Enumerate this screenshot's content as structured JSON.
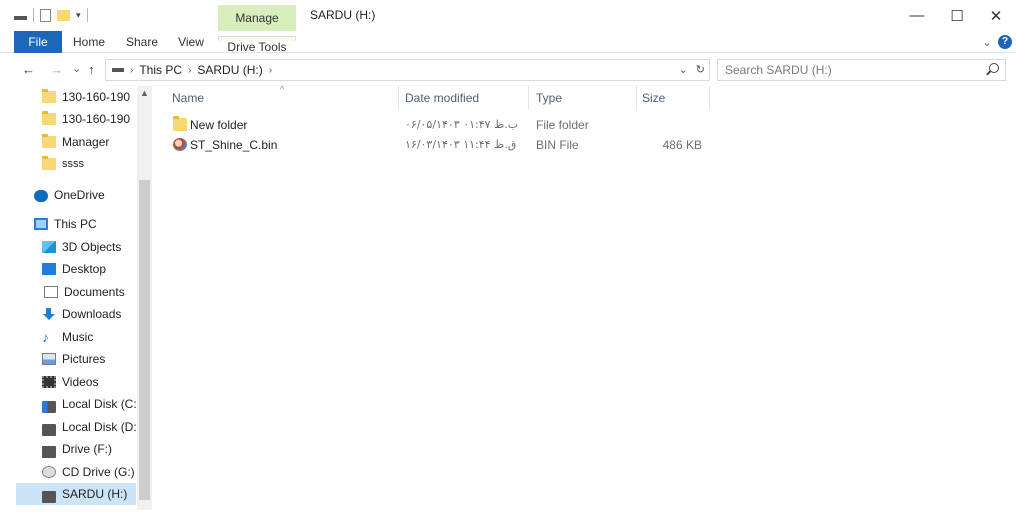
{
  "titlebar": {
    "manage_tab": "Manage",
    "title": "SARDU (H:)",
    "minimize": "—",
    "maximize": "☐",
    "close": "✕"
  },
  "ribbon": {
    "tabs": [
      "File",
      "Home",
      "Share",
      "View",
      "Drive Tools"
    ],
    "collapse": "⌄",
    "help": "?"
  },
  "address": {
    "back": "←",
    "forward": "→",
    "recent": "⌄",
    "up": "↑",
    "crumbs": [
      "This PC",
      "SARDU (H:)"
    ],
    "dropdown": "⌄",
    "refresh": "↻",
    "search_placeholder": "Search SARDU (H:)"
  },
  "navpane": {
    "items": [
      {
        "label": "130-160-190",
        "icon": "folder-icon"
      },
      {
        "label": "130-160-190",
        "icon": "folder-icon"
      },
      {
        "label": "Manager",
        "icon": "folder-icon"
      },
      {
        "label": "ssss",
        "icon": "folder-icon"
      },
      {
        "label": "OneDrive",
        "icon": "onedrive-icon"
      },
      {
        "label": "This PC",
        "icon": "this-pc-icon"
      },
      {
        "label": "3D Objects",
        "icon": "3d-objects-icon"
      },
      {
        "label": "Desktop",
        "icon": "desktop-icon"
      },
      {
        "label": "Documents",
        "icon": "documents-icon"
      },
      {
        "label": "Downloads",
        "icon": "downloads-icon"
      },
      {
        "label": "Music",
        "icon": "music-icon"
      },
      {
        "label": "Pictures",
        "icon": "pictures-icon"
      },
      {
        "label": "Videos",
        "icon": "videos-icon"
      },
      {
        "label": "Local Disk (C:)",
        "icon": "local-disk-icon"
      },
      {
        "label": "Local Disk (D:)",
        "icon": "drive-icon"
      },
      {
        "label": "Drive (F:)",
        "icon": "drive-icon"
      },
      {
        "label": "CD Drive (G:) EN",
        "icon": "cd-drive-icon"
      },
      {
        "label": "SARDU (H:)",
        "icon": "drive-icon",
        "selected": true
      }
    ]
  },
  "filelist": {
    "columns": [
      "Name",
      "Date modified",
      "Type",
      "Size"
    ],
    "rows": [
      {
        "name": "New folder",
        "date": "۰۶/۰۵/۱۴۰۳ ب.ظ ۰۱:۴۷",
        "type": "File folder",
        "size": "",
        "icon": "folder-icon"
      },
      {
        "name": "ST_Shine_C.bin",
        "date": "۱۶/۰۳/۱۴۰۳ ق.ظ ۱۱:۴۴",
        "type": "BIN File",
        "size": "486 KB",
        "icon": "bin-file-icon"
      }
    ]
  }
}
